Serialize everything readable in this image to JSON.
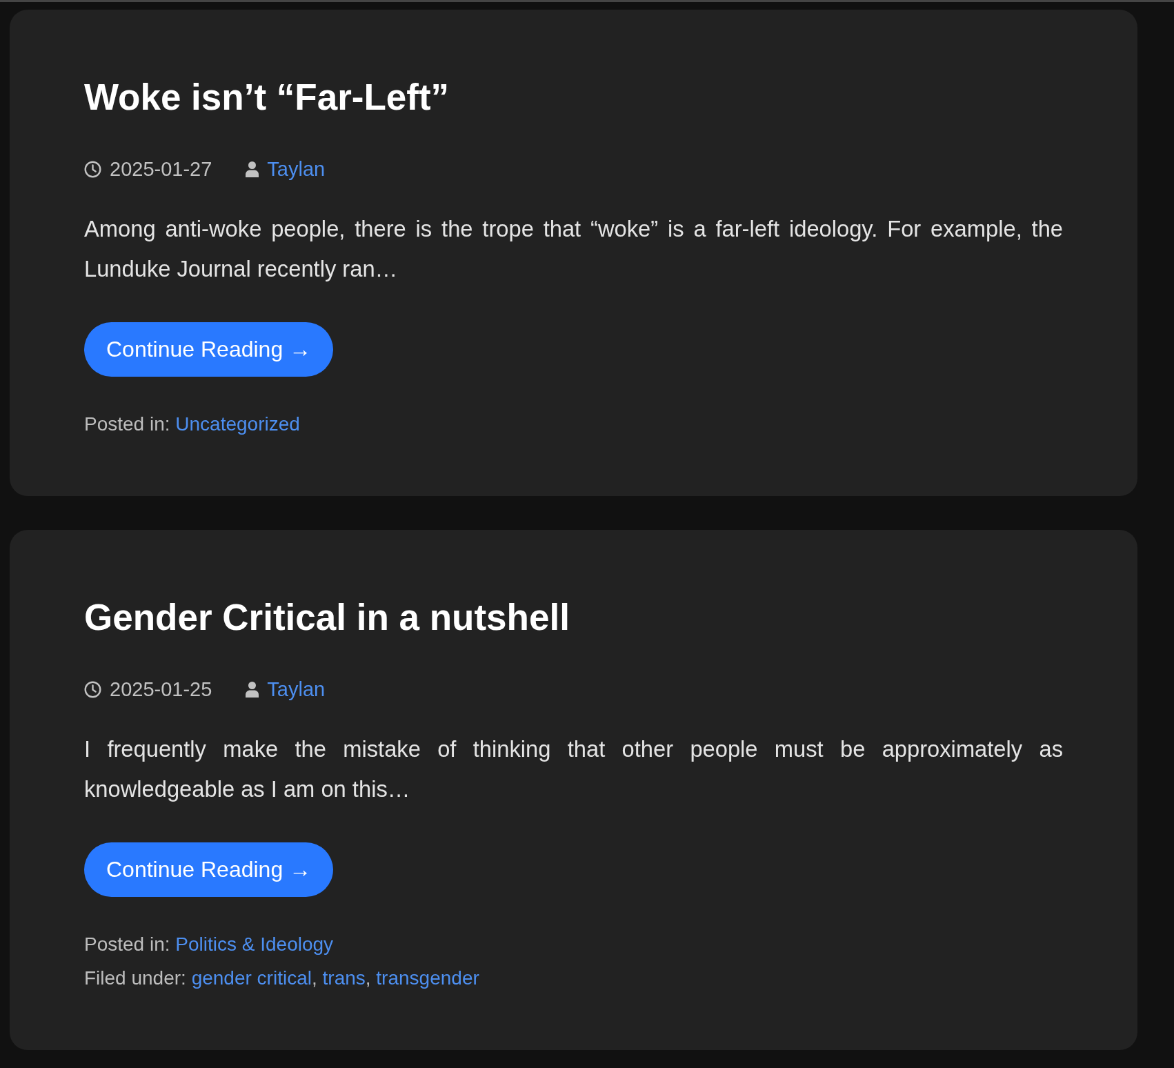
{
  "posts": [
    {
      "title": "Woke isn’t “Far-Left”",
      "date": "2025-01-27",
      "author": "Taylan",
      "excerpt": "Among anti-woke people, there is the trope that “woke” is a far-left ideology. For example, the Lunduke Journal recently ran…",
      "button": "Continue Reading →",
      "footer_lines": [
        {
          "label": "Posted in:",
          "links": [
            "Uncategorized"
          ]
        }
      ]
    },
    {
      "title": "Gender Critical in a nutshell",
      "date": "2025-01-25",
      "author": "Taylan",
      "excerpt": "I frequently make the mistake of thinking that other people must be approximately as knowledgeable as I am on this…",
      "button": "Continue Reading →",
      "footer_lines": [
        {
          "label": "Posted in:",
          "links": [
            "Politics & Ideology"
          ]
        },
        {
          "label": "Filed under:",
          "separator": ",",
          "links": [
            "gender critical",
            "trans",
            "transgender"
          ]
        }
      ]
    }
  ]
}
